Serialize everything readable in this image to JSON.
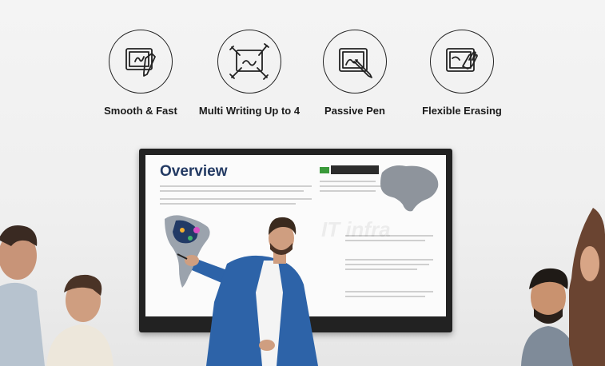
{
  "features": [
    {
      "id": "smooth",
      "label": "Smooth & Fast",
      "icon": "tablet-pen-icon"
    },
    {
      "id": "multi",
      "label": "Multi Writing Up to 4",
      "icon": "multi-pen-icon"
    },
    {
      "id": "passive",
      "label": "Passive Pen",
      "icon": "passive-pen-icon"
    },
    {
      "id": "erase",
      "label": "Flexible Erasing",
      "icon": "hand-erase-icon"
    }
  ],
  "screen": {
    "title": "Overview",
    "watermark": "IT infra"
  },
  "colors": {
    "icon_stroke": "#222222",
    "screen_title": "#233a63",
    "suit": "#2d63a8",
    "bezel": "#222222"
  }
}
